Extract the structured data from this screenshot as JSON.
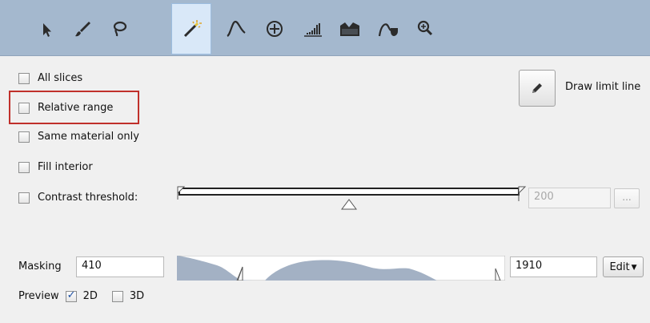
{
  "toolbar": {
    "tools": [
      {
        "name": "pointer-icon"
      },
      {
        "name": "brush-icon"
      },
      {
        "name": "lasso-icon"
      },
      {
        "name": "magic-wand-icon",
        "active": true
      },
      {
        "name": "curve-icon"
      },
      {
        "name": "move-crosshair-icon"
      },
      {
        "name": "histogram-icon"
      },
      {
        "name": "mountains-icon"
      },
      {
        "name": "smooth-curve-icon"
      },
      {
        "name": "zoom-icon"
      }
    ],
    "background": "#a4b8ce",
    "active_background": "#d9e8f8"
  },
  "options": {
    "all_slices": {
      "label": "All slices",
      "checked": false
    },
    "relative_range": {
      "label": "Relative range",
      "checked": false
    },
    "same_material_only": {
      "label": "Same material only",
      "checked": false
    },
    "fill_interior": {
      "label": "Fill interior",
      "checked": false
    },
    "contrast_threshold": {
      "label": "Contrast threshold:",
      "checked": false,
      "value": "200",
      "more_button": "..."
    }
  },
  "draw_limit": {
    "label": "Draw limit line",
    "icon": "pencil-icon"
  },
  "masking": {
    "label": "Masking",
    "min_value": "410",
    "max_value": "1910",
    "edit_label": "Edit"
  },
  "preview": {
    "label": "Preview",
    "2d": {
      "label": "2D",
      "checked": true
    },
    "3d": {
      "label": "3D",
      "checked": false
    }
  },
  "colors": {
    "highlight": "#c0302b",
    "histogram_fill": "#a3b1c4"
  }
}
